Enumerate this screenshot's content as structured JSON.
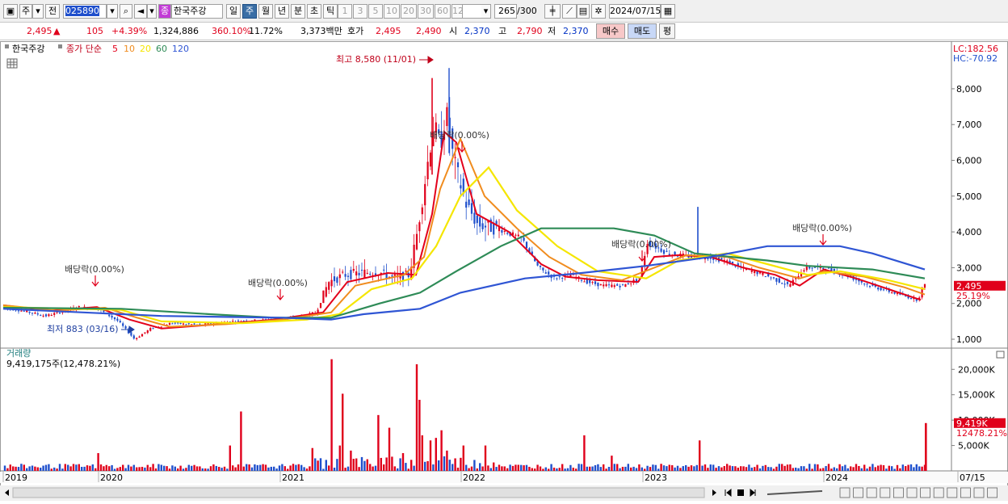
{
  "toolbar": {
    "market_type": "주",
    "prev_label": "전",
    "stock_code": "025890",
    "stock_name": "한국주강",
    "name_prefix": "종",
    "periods": [
      "일",
      "주",
      "월",
      "년",
      "분",
      "초",
      "틱"
    ],
    "selected_period": "주",
    "intervals": [
      "1",
      "3",
      "5",
      "10",
      "20",
      "30",
      "60",
      "120"
    ],
    "count_value": "265",
    "count_total": "/300",
    "date": "2024/07/15"
  },
  "quote": {
    "price": "2,495",
    "change_arrow": "▲",
    "change": "105",
    "change_pct": "+4.39%",
    "volume": "1,324,886",
    "volume_ratio": "360.10%",
    "turnover": "11.72%",
    "amount": "3,373백만",
    "bid_ask_label": "호가",
    "ask": "2,495",
    "bid": "2,490",
    "open_label": "시",
    "open": "2,370",
    "high_label": "고",
    "high": "2,790",
    "low_label": "저",
    "low": "2,370",
    "buy_label": "매수",
    "sell_label": "매도",
    "eval_label": "평"
  },
  "price_panel": {
    "stock_label": "한국주강",
    "ma_prefix": "종가 단순",
    "ma_periods": [
      "5",
      "10",
      "20",
      "60",
      "120"
    ],
    "lc_label": "LC:182.56",
    "hc_label": "HC:-70.92",
    "y_ticks": [
      "8,000",
      "7,000",
      "6,000",
      "5,000",
      "4,000",
      "3,000",
      "2,000",
      "1,000"
    ],
    "current_price_tag": "2,495",
    "current_pct_tag": "25.19%",
    "high_annotation": "최고 8,580 (11/01)",
    "low_annotation": "최저 883 (03/16)",
    "dividend_annotations": [
      "배당락(0.00%)",
      "배당락(0.00%)",
      "배당락(0.00%)",
      "배당락(0.00%)",
      "배당락(0.00%)"
    ]
  },
  "volume_panel": {
    "label": "거래량",
    "sub_label": "9,419,175주(12,478.21%)",
    "y_ticks": [
      "20,000K",
      "15,000K",
      "10,000K",
      "5,000K"
    ],
    "current_tag": "9,419K",
    "ratio_tag": "12478.21%"
  },
  "x_axis": {
    "labels": [
      "2019",
      "2020",
      "2021",
      "2022",
      "2023",
      "2024",
      "07/15"
    ]
  },
  "colors": {
    "up": "#e0001b",
    "down": "#1f4fcc",
    "ma5": "#e3001b",
    "ma10": "#f08c1e",
    "ma20": "#f5e600",
    "ma60": "#2e8b57",
    "ma120": "#2f55d4"
  },
  "chart_data": {
    "type": "candlestick",
    "title": "한국주강",
    "ylim": [
      700,
      8700
    ],
    "x": [
      "2019",
      "2020",
      "2021",
      "2022",
      "2023",
      "2024",
      "2024/07/15"
    ],
    "close": [
      1950,
      1550,
      1500,
      5500,
      2800,
      2600,
      2495
    ],
    "series": [
      {
        "name": "5",
        "values": [
          1920,
          1600,
          1520,
          5800,
          2850,
          2700,
          2200
        ]
      },
      {
        "name": "10",
        "values": [
          1900,
          1620,
          1530,
          6000,
          2900,
          2700,
          2350
        ]
      },
      {
        "name": "20",
        "values": [
          1880,
          1650,
          1560,
          5500,
          2950,
          2800,
          2400
        ]
      },
      {
        "name": "60",
        "values": [
          1850,
          1720,
          1560,
          3600,
          4100,
          3100,
          2700
        ]
      },
      {
        "name": "120",
        "values": [
          1800,
          1750,
          1520,
          2400,
          3100,
          3600,
          2900
        ]
      }
    ],
    "highest": {
      "value": 8580,
      "date": "11/01"
    },
    "lowest": {
      "value": 883,
      "date": "03/16"
    },
    "volume_ylim": [
      0,
      22500
    ],
    "volume_unit": "K"
  }
}
